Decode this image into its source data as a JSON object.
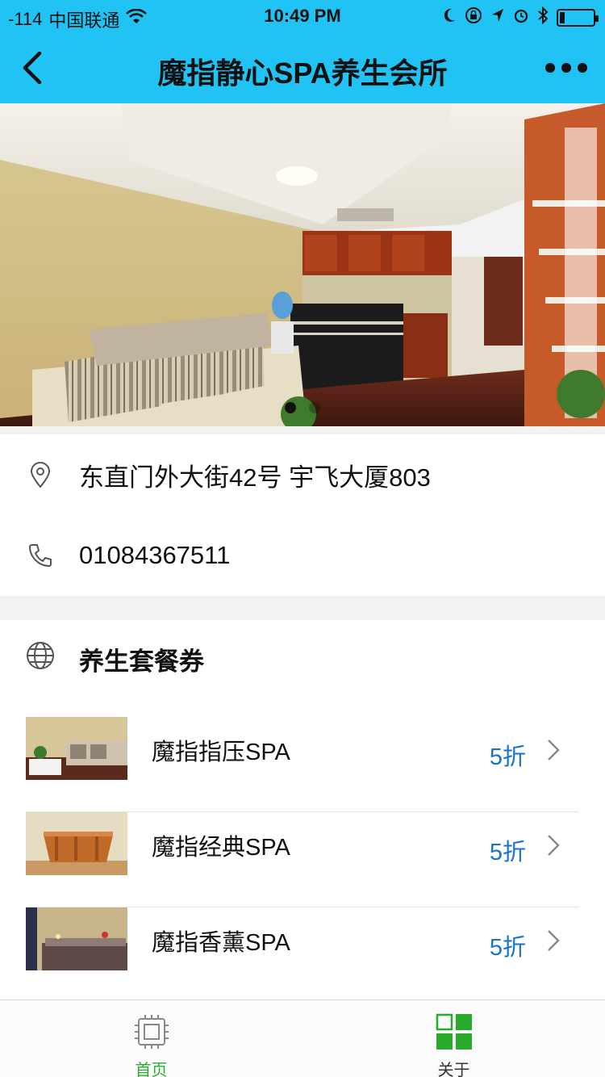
{
  "status_bar": {
    "signal": "-114",
    "carrier": "中国联通",
    "time": "10:49 PM",
    "battery_level": 0.16
  },
  "nav": {
    "title": "魔指静心SPA养生会所",
    "back_icon": "back-arrow-icon",
    "more_icon": "more-dots-icon"
  },
  "banner": {
    "slide_count": 2,
    "active_index": 0
  },
  "info": {
    "address": "东直门外大街42号 宇飞大厦803",
    "phone": "01084367511",
    "address_icon": "location-pin-icon",
    "phone_icon": "phone-icon"
  },
  "coupons": {
    "header": "养生套餐券",
    "header_icon": "globe-icon",
    "items": [
      {
        "name": "魔指指压SPA",
        "discount": "5折"
      },
      {
        "name": "魔指经典SPA",
        "discount": "5折"
      },
      {
        "name": "魔指香薰SPA",
        "discount": "5折"
      }
    ]
  },
  "tabbar": {
    "tabs": [
      {
        "label": "首页",
        "icon": "chip-icon",
        "active": true
      },
      {
        "label": "关于",
        "icon": "grid-icon",
        "active": false
      }
    ]
  },
  "colors": {
    "header": "#20c3f3",
    "discount": "#1a73c9",
    "tab_active": "#2aaa2a"
  }
}
